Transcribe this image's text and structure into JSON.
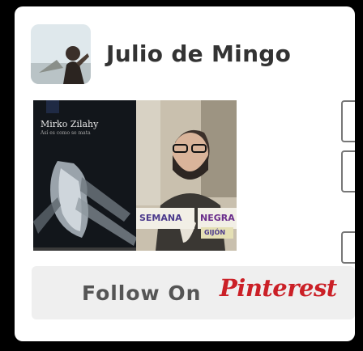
{
  "profile": {
    "name": "Julio de Mingo",
    "avatar_icon": "profile-photo"
  },
  "pins": [
    {
      "kind": "book-cover",
      "author": "Mirko Zilahy",
      "title": "Así es como se mata"
    },
    {
      "kind": "portrait-photo",
      "signs": [
        "SEMANA",
        "NEGRA",
        "GIJÓN"
      ]
    }
  ],
  "follow": {
    "label": "Follow On",
    "brand": "Pinterest",
    "brand_color": "#cb2027"
  },
  "colors": {
    "background": "#000000",
    "card": "#ffffff",
    "follow_bg": "#efefef"
  }
}
